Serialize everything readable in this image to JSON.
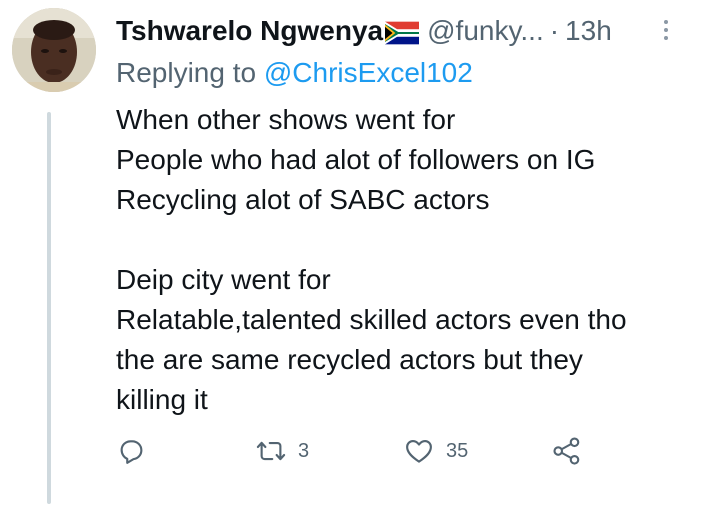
{
  "tweet": {
    "display_name": "Tshwarelo Ngwenya",
    "handle": "@funky...",
    "separator": "·",
    "time": "13h",
    "reply": {
      "prefix": "Replying to",
      "handle": "@ChrisExcel102"
    },
    "text_lines": [
      "When other shows went for",
      "People who had alot of followers on IG",
      "Recycling alot of SABC actors",
      "",
      "Deip city went for",
      "Relatable,talented skilled actors even tho",
      "the are same recycled actors but they",
      "killing it"
    ]
  },
  "actions": {
    "reply": {
      "icon": "reply-icon"
    },
    "retweet": {
      "icon": "retweet-icon",
      "count": "3"
    },
    "like": {
      "icon": "heart-icon",
      "count": "35"
    },
    "share": {
      "icon": "share-icon"
    }
  },
  "colors": {
    "text_primary": "#0f1419",
    "text_secondary": "#536471",
    "accent": "#1d9bf0",
    "thread_line": "#cfd9de"
  }
}
